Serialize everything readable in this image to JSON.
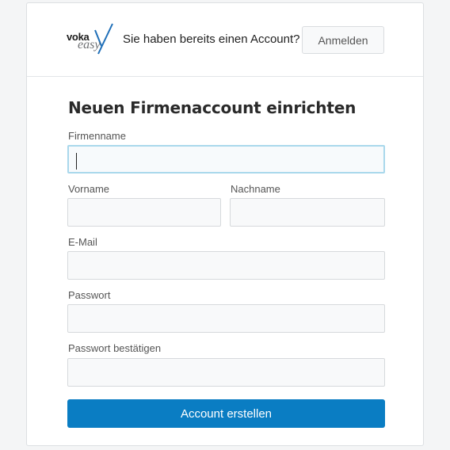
{
  "header": {
    "logo_primary": "voka",
    "logo_secondary": "easy",
    "prompt_text": "Sie haben bereits einen Account?",
    "login_label": "Anmelden"
  },
  "form": {
    "title": "Neuen Firmenaccount einrichten",
    "fields": {
      "company": {
        "label": "Firmenname",
        "value": ""
      },
      "first_name": {
        "label": "Vorname",
        "value": ""
      },
      "last_name": {
        "label": "Nachname",
        "value": ""
      },
      "email": {
        "label": "E-Mail",
        "value": ""
      },
      "password": {
        "label": "Passwort",
        "value": ""
      },
      "password_confirm": {
        "label": "Passwort bestätigen",
        "value": ""
      }
    },
    "submit_label": "Account erstellen"
  },
  "colors": {
    "primary_button": "#0a7dc3",
    "focus_border": "#a9d8ec",
    "logo_accent": "#1f6fb8"
  }
}
